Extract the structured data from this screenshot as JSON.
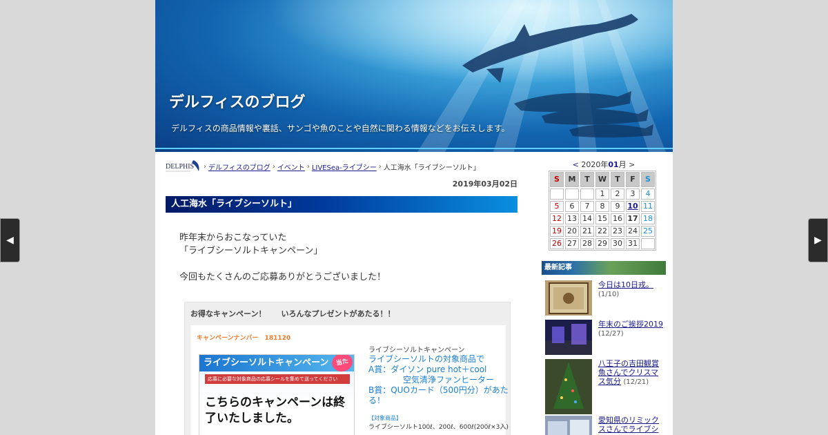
{
  "header": {
    "blog_title": "デルフィスのブログ",
    "description": "デルフィスの商品情報や裏話、サンゴや魚のことや自然に関わる情報などをお伝えします。"
  },
  "breadcrumb": {
    "logo_text": "DELPHIS",
    "items": [
      "デルフィスのブログ",
      "イベント",
      "LIVESea-ライブシー"
    ],
    "current": "人工海水「ライブシーソルト」",
    "separator": "›"
  },
  "post": {
    "date": "2019年03月02日",
    "title": "人工海水「ライブシーソルト」",
    "paragraphs": [
      "昨年末からおこなっていた",
      "「ライブシーソルトキャンペーン」",
      "今回もたくさんのご応募ありがとうございました！"
    ]
  },
  "campaign": {
    "header": "お得なキャンペーン！　　いろんなプレゼントがあたる！！",
    "number": "キャンペーンナンバー　181120",
    "image_title": "ライブシーソルトキャンペーン",
    "image_badge": "当たる!",
    "image_sub": "応募に必要な対象商品の応募シールを集めて送ってください",
    "ended": "こちらのキャンペーンは終了いたしました。",
    "right_small": "ライブシーソルトキャンペーン",
    "right_lines": [
      "ライブシーソルトの対象商品で",
      "A賞：ダイソン pure hot＋cool",
      "空気清浄ファンヒーター",
      "B賞：QUOカード（500円分）があたる！"
    ],
    "target_tag": "【対象商品】",
    "target_text": "ライブシーソルト100ℓ、200ℓ、600ℓ(200ℓ×3入)"
  },
  "calendar": {
    "prev": "<",
    "year": "2020年",
    "month": "01",
    "month_suffix": "月",
    "next": ">",
    "weekdays": [
      "S",
      "M",
      "T",
      "W",
      "T",
      "F",
      "S"
    ],
    "weeks": [
      [
        "",
        "",
        "",
        "1",
        "2",
        "3",
        "4"
      ],
      [
        "5",
        "6",
        "7",
        "8",
        "9",
        "10",
        "11"
      ],
      [
        "12",
        "13",
        "14",
        "15",
        "16",
        "17",
        "18"
      ],
      [
        "19",
        "20",
        "21",
        "22",
        "23",
        "24",
        "25"
      ],
      [
        "26",
        "27",
        "28",
        "29",
        "30",
        "31",
        ""
      ]
    ],
    "linked_days": [
      "10"
    ],
    "bold_days": [
      "17"
    ]
  },
  "recent": {
    "header": "最新記事",
    "items": [
      {
        "title": "今日は10日戎。",
        "date": "(1/10)"
      },
      {
        "title": "年末のご挨拶2019",
        "date": "(12/27)"
      },
      {
        "title": "八王子の吉田観賞魚さんでクリスマス気分",
        "date": "(12/21)"
      },
      {
        "title": "愛知県のリミックスさんでライブシ",
        "date": ""
      }
    ]
  },
  "nav": {
    "prev_glyph": "◀",
    "next_glyph": "▶"
  }
}
